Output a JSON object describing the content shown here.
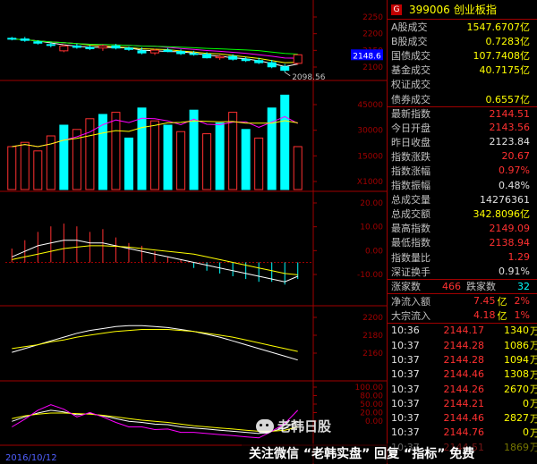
{
  "quote_panel": {
    "badge": "G",
    "code": "399006",
    "name": "创业板指",
    "stats": [
      {
        "label": "A股成交",
        "value": "1547.6707亿",
        "color": "yel"
      },
      {
        "label": "B股成交",
        "value": "0.7283亿",
        "color": "yel"
      },
      {
        "label": "国债成交",
        "value": "107.7408亿",
        "color": "yel"
      },
      {
        "label": "基金成交",
        "value": "40.7175亿",
        "color": "yel"
      },
      {
        "label": "权证成交",
        "value": "",
        "color": "yel"
      },
      {
        "label": "债券成交",
        "value": "0.6557亿",
        "color": "yel"
      },
      {
        "label": "最新指数",
        "value": "2144.51",
        "color": "red"
      },
      {
        "label": "今日开盘",
        "value": "2143.56",
        "color": "red"
      },
      {
        "label": "昨日收盘",
        "value": "2123.84",
        "color": "wht"
      },
      {
        "label": "指数涨跌",
        "value": "20.67",
        "color": "red"
      },
      {
        "label": "指数涨幅",
        "value": "0.97%",
        "color": "red"
      },
      {
        "label": "指数振幅",
        "value": "0.48%",
        "color": "wht"
      },
      {
        "label": "总成交量",
        "value": "14276361",
        "color": "wht"
      },
      {
        "label": "总成交额",
        "value": "342.8096亿",
        "color": "yel"
      },
      {
        "label": "最高指数",
        "value": "2149.09",
        "color": "red"
      },
      {
        "label": "最低指数",
        "value": "2138.94",
        "color": "red"
      },
      {
        "label": "指数量比",
        "value": "1.29",
        "color": "red"
      },
      {
        "label": "深证换手",
        "value": "0.91%",
        "color": "wht"
      }
    ],
    "counts": {
      "up_label": "涨家数",
      "up": "466",
      "down_label": "跌家数",
      "down": "32"
    },
    "flows": [
      {
        "label": "净流入额",
        "value": "7.45",
        "unit": "亿",
        "pct": "2%"
      },
      {
        "label": "大宗流入",
        "value": "4.18",
        "unit": "亿",
        "pct": "1%"
      }
    ],
    "ticks": [
      {
        "time": "10:36",
        "price": "2144.17",
        "vol": "1340",
        "unit": "万"
      },
      {
        "time": "10:37",
        "price": "2144.28",
        "vol": "1086",
        "unit": "万"
      },
      {
        "time": "10:37",
        "price": "2144.28",
        "vol": "1094",
        "unit": "万"
      },
      {
        "time": "10:37",
        "price": "2144.46",
        "vol": "1308",
        "unit": "万"
      },
      {
        "time": "10:37",
        "price": "2144.26",
        "vol": "2670",
        "unit": "万"
      },
      {
        "time": "10:37",
        "price": "2144.21",
        "vol": "0",
        "unit": "万"
      },
      {
        "time": "10:37",
        "price": "2144.46",
        "vol": "2827",
        "unit": "万"
      },
      {
        "time": "10:37",
        "price": "2144.76",
        "vol": "0",
        "unit": "万"
      },
      {
        "time": "10:37",
        "price": "2144.51",
        "vol": "1869",
        "unit": "万"
      }
    ]
  },
  "chart_data": [
    {
      "type": "candlestick",
      "panel": "price",
      "axis_labels": [
        "2250",
        "2200",
        "2150",
        "2100"
      ],
      "ylim": [
        2080,
        2270
      ],
      "last_price_tag": "2148.6",
      "low_annotation": "2098.56",
      "candles": [
        [
          2196,
          2200,
          2190,
          2194
        ],
        [
          2194,
          2200,
          2186,
          2190
        ],
        [
          2186,
          2190,
          2178,
          2182
        ],
        [
          2178,
          2184,
          2170,
          2176
        ],
        [
          2160,
          2178,
          2156,
          2174
        ],
        [
          2174,
          2180,
          2166,
          2170
        ],
        [
          2170,
          2176,
          2162,
          2166
        ],
        [
          2168,
          2178,
          2160,
          2174
        ],
        [
          2174,
          2180,
          2164,
          2168
        ],
        [
          2168,
          2172,
          2160,
          2164
        ],
        [
          2160,
          2170,
          2150,
          2154
        ],
        [
          2154,
          2166,
          2148,
          2162
        ],
        [
          2162,
          2168,
          2156,
          2158
        ],
        [
          2158,
          2164,
          2148,
          2152
        ],
        [
          2152,
          2160,
          2146,
          2150
        ],
        [
          2150,
          2156,
          2138,
          2140
        ],
        [
          2140,
          2148,
          2134,
          2144
        ],
        [
          2144,
          2150,
          2132,
          2136
        ],
        [
          2136,
          2142,
          2128,
          2132
        ],
        [
          2132,
          2140,
          2122,
          2126
        ],
        [
          2126,
          2134,
          2110,
          2114
        ],
        [
          2114,
          2122,
          2098.56,
          2104
        ],
        [
          2124,
          2150,
          2120,
          2148.6
        ]
      ]
    },
    {
      "type": "bar",
      "panel": "volume",
      "axis_labels": [
        "45000",
        "30000",
        "15000",
        "X1000"
      ],
      "ylim": [
        0,
        50000
      ],
      "values": [
        20000,
        22000,
        18000,
        25000,
        30000,
        28000,
        33000,
        35000,
        36000,
        24000,
        38000,
        32000,
        30000,
        27000,
        37000,
        26000,
        31000,
        36000,
        28000,
        24000,
        38000,
        44000,
        20000
      ],
      "up": [
        false,
        false,
        false,
        false,
        true,
        false,
        false,
        true,
        false,
        true,
        true,
        false,
        true,
        false,
        true,
        false,
        true,
        false,
        true,
        false,
        true,
        true,
        false
      ]
    },
    {
      "type": "bar",
      "panel": "macd",
      "axis_labels": [
        "20.00",
        "10.00",
        "0.00",
        "-10.00"
      ],
      "ylim": [
        -15,
        25
      ],
      "values": [
        5,
        8,
        11,
        13,
        14,
        13,
        11,
        12,
        9,
        7,
        6,
        4,
        2,
        1,
        -2,
        -3,
        -4,
        -5,
        -6,
        -7,
        -7,
        -8,
        -6
      ],
      "dif": [
        2,
        4,
        6,
        7,
        8,
        8,
        7,
        7,
        6,
        5,
        4,
        3,
        2,
        1,
        0,
        -1,
        -2,
        -3,
        -4,
        -5,
        -6,
        -7,
        -5
      ],
      "dea": [
        1,
        2,
        3,
        4,
        5,
        5.5,
        6,
        6,
        5.8,
        5.5,
        5,
        4.5,
        4,
        3.5,
        3,
        2,
        1,
        0,
        -1,
        -2,
        -3,
        -4,
        -4.5
      ]
    },
    {
      "type": "line",
      "panel": "ma",
      "axis_labels": [
        "2200",
        "2180",
        "2160"
      ],
      "ylim": [
        2140,
        2215
      ],
      "series": [
        {
          "values": [
            2168,
            2172,
            2176,
            2180,
            2184,
            2188,
            2191,
            2193,
            2195,
            2196,
            2196,
            2195,
            2194,
            2192,
            2190,
            2187,
            2184,
            2180,
            2176,
            2172,
            2168,
            2164,
            2160
          ],
          "color": "#ffffff"
        },
        {
          "values": [
            2172,
            2174,
            2176,
            2179,
            2181,
            2184,
            2186,
            2188,
            2190,
            2191,
            2192,
            2192,
            2192,
            2191,
            2190,
            2188,
            2186,
            2184,
            2181,
            2178,
            2175,
            2172,
            2169
          ],
          "color": "#ffff00"
        }
      ]
    },
    {
      "type": "line",
      "panel": "kdj",
      "axis_labels": [
        "100.00",
        "80.00",
        "50.00",
        "20.00",
        "0.00"
      ],
      "ylim": [
        0,
        110
      ],
      "series": [
        {
          "values": [
            40,
            48,
            55,
            60,
            57,
            52,
            54,
            50,
            45,
            40,
            38,
            35,
            34,
            30,
            28,
            26,
            24,
            22,
            20,
            18,
            22,
            28,
            40
          ],
          "color": "#ffffff"
        },
        {
          "values": [
            45,
            50,
            53,
            55,
            55,
            54,
            53,
            51,
            48,
            45,
            42,
            40,
            38,
            35,
            32,
            30,
            28,
            26,
            24,
            22,
            22,
            24,
            30
          ],
          "color": "#ffff00"
        },
        {
          "values": [
            30,
            44,
            60,
            70,
            62,
            48,
            56,
            48,
            38,
            30,
            30,
            25,
            26,
            20,
            20,
            18,
            16,
            14,
            12,
            10,
            22,
            36,
            60
          ],
          "color": "#ff00ff"
        }
      ]
    }
  ],
  "watermark": {
    "text": "关注微信 “老韩实盘” 回复 “指标” 免费",
    "logo_text": "老韩日股"
  },
  "date_label": "2016/10/12"
}
